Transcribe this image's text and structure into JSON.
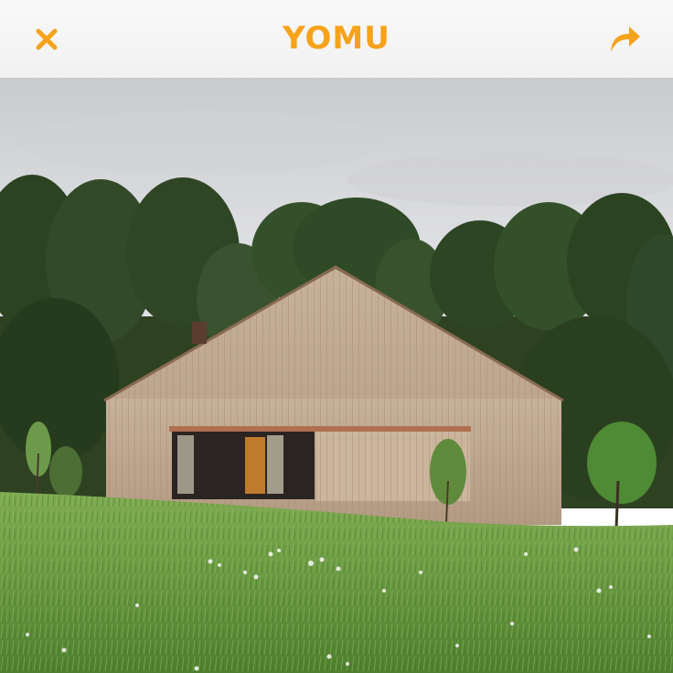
{
  "header": {
    "brand": "YOMU",
    "close_icon": "close-x-icon",
    "share_icon": "share-arrow-icon",
    "accent_color": "#f7a21b",
    "bar_color": "#f4f4f4"
  },
  "photo": {
    "subject": "photo-wooden-house-in-meadow"
  }
}
